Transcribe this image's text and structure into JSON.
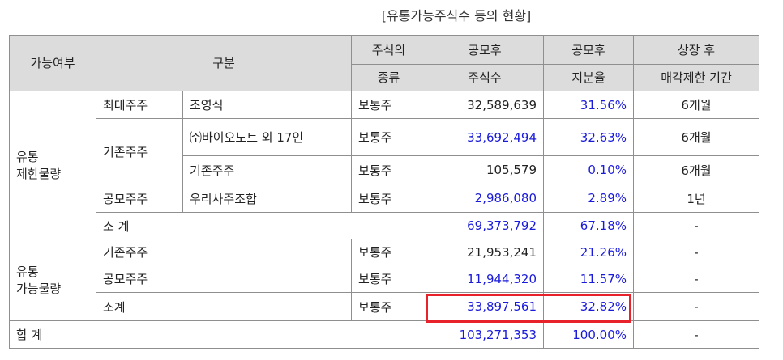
{
  "caption": "[유통가능주식수 등의 현황]",
  "header": {
    "col1": "가능여부",
    "col2": "구분",
    "col3_l1": "주식의",
    "col3_l2": "종류",
    "col4_l1": "공모후",
    "col4_l2": "주식수",
    "col5_l1": "공모후",
    "col5_l2": "지분율",
    "col6_l1": "상장 후",
    "col6_l2": "매각제한 기간"
  },
  "restricted": {
    "label_l1": "유통",
    "label_l2": "제한물량",
    "largest": {
      "group": "최대주주",
      "name": "조영식",
      "type": "보통주",
      "shares": "32,589,639",
      "ratio": "31.56%",
      "period": "6개월"
    },
    "existing_group": "기존주주",
    "existing_a": {
      "name": "㈜바이오노트 외 17인",
      "type": "보통주",
      "shares": "33,692,494",
      "ratio": "32.63%",
      "period": "6개월"
    },
    "existing_b": {
      "name": "기존주주",
      "type": "보통주",
      "shares": "105,579",
      "ratio": "0.10%",
      "period": "6개월"
    },
    "offering": {
      "group": "공모주주",
      "name": "우리사주조합",
      "type": "보통주",
      "shares": "2,986,080",
      "ratio": "2.89%",
      "period": "1년"
    },
    "subtotal": {
      "label": "소 계",
      "shares": "69,373,792",
      "ratio": "67.18%",
      "period": "-"
    }
  },
  "tradable": {
    "label_l1": "유통",
    "label_l2": "가능물량",
    "existing": {
      "name": "기존주주",
      "type": "보통주",
      "shares": "21,953,241",
      "ratio": "21.26%",
      "period": "-"
    },
    "offering": {
      "name": "공모주주",
      "type": "보통주",
      "shares": "11,944,320",
      "ratio": "11.57%",
      "period": "-"
    },
    "subtotal": {
      "label": "소계",
      "type": "보통주",
      "shares": "33,897,561",
      "ratio": "32.82%",
      "period": "-"
    }
  },
  "total": {
    "label": "합 계",
    "shares": "103,271,353",
    "ratio": "100.00%",
    "period": "-"
  },
  "colors": {
    "header_bg": "#dcdcdc",
    "blue_text": "#1a1adb",
    "highlight_border": "#e8222a"
  }
}
